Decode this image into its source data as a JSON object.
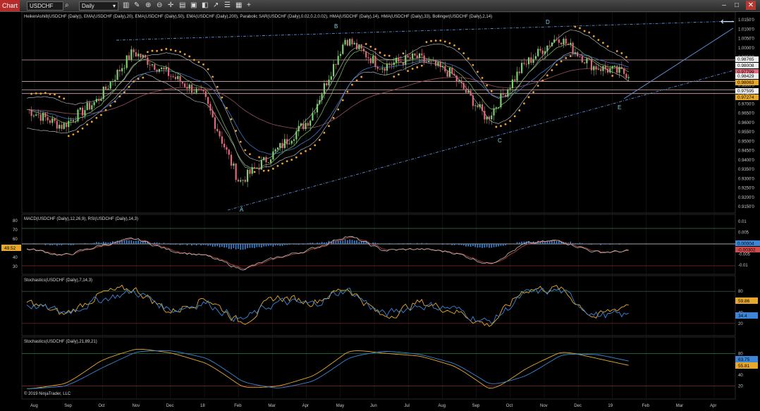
{
  "toolbar": {
    "app_label": "Chart",
    "instrument": "USDCHF",
    "interval": "Daily"
  },
  "icons": [
    "search-icon",
    "chevron-down-icon",
    "bar-style-icon",
    "draw-icon",
    "zoom-in-icon",
    "zoom-out-icon",
    "crosshair-icon",
    "properties-icon",
    "lock-icon",
    "data-box-icon",
    "drawing-tools-icon",
    "objects-icon",
    "templates-icon",
    "add-icon",
    "minimize-icon",
    "maximize-icon",
    "close-icon"
  ],
  "colors": {
    "up": "#7cd16e",
    "down": "#e06a7c",
    "sar": "#f2a030",
    "ema20": "#6fae5a",
    "ema50": "#3f78c4",
    "ema200": "#9b4f5a",
    "bollinger": "#c9c9c9",
    "trendline": "#5b8fd6",
    "hline": "#d9a8a8",
    "macd": "#cfcfcf",
    "signal": "#c94a3c",
    "hist": "#3b86d8",
    "stoch_d": "#3b86d8",
    "stoch_k": "#e8a92a"
  },
  "panels": {
    "price": {
      "label": "HeikenAshi8(USDCHF (Daily)), EMA(USDCHF (Daily),20), EMA(USDCHF (Daily),50), EMA(USDCHF (Daily),200), Parabolic SAR(USDCHF (Daily),0.02,0.2,0.02), HMA(USDCHF (Daily),14), HMA(USDCHF (Daily),33), Bollinger(USDCHF (Daily),2,14)"
    },
    "macd": {
      "label": "MACD(USDCHF (Daily),12,26,9), RSI(USDCHF (Daily),14,3)",
      "rsi_tag": "49.52",
      "macd_tag": "0.00004",
      "signal_tag": "-0.00302"
    },
    "stoch1": {
      "label": "Stochastics(USDCHF (Daily),7,14,3)",
      "k_tag": "59.86",
      "d_tag": "34.4"
    },
    "stoch2": {
      "label": "Stochastics(USDCHF (Daily),21,89,21)",
      "d_tag": "63.75",
      "k_tag": "55.81"
    }
  },
  "copyright": "© 2019 NinjaTrader, LLC",
  "price_axis": [
    "1.0150'0",
    "1.0100'0",
    "1.0050'0",
    "1.0000'0",
    "0.9950'0",
    "0.9900'0",
    "0.9850'0",
    "0.9800'0",
    "0.9750'0",
    "0.9700'0",
    "0.9650'0",
    "0.9600'0",
    "0.9550'0",
    "0.9500'0",
    "0.9450'0",
    "0.9400'0",
    "0.9350'0",
    "0.9300'0",
    "0.9250'0",
    "0.9200'0",
    "0.9150'0"
  ],
  "price_tags": [
    {
      "text": "0.98765",
      "color": "#f0f0f0"
    },
    {
      "text": "0.98008",
      "color": "#f0f0f0"
    },
    {
      "text": "0.97799",
      "color": "#e06a7c"
    },
    {
      "text": "0.98429",
      "color": "#f0f0f0"
    },
    {
      "text": "0.98063",
      "color": "#e8a92a"
    },
    {
      "text": "0.97595",
      "color": "#f0f0f0"
    },
    {
      "text": "0.97274",
      "color": "#e8a92a"
    }
  ],
  "macd_axis_left": [
    "80",
    "70",
    "60",
    "50",
    "40",
    "30"
  ],
  "macd_axis_right": [
    "0.01",
    "0.005",
    "0",
    "-0.005",
    "-0.01"
  ],
  "stoch_axis": [
    "80",
    "60",
    "40",
    "20"
  ],
  "x_axis": [
    "Aug",
    "Sep",
    "Oct",
    "Nov",
    "Dec",
    "18",
    "Feb",
    "Mar",
    "Apr",
    "May",
    "Jun",
    "Jul",
    "Aug",
    "Sep",
    "Oct",
    "Nov",
    "Dec",
    "19",
    "Feb",
    "Mar",
    "Apr"
  ],
  "wave_labels": [
    "A",
    "B",
    "C",
    "D",
    "E"
  ],
  "chart_data": [
    {
      "type": "candlestick",
      "title": "HeikenAshi8(USDCHF (Daily))",
      "x": [
        "Aug",
        "Sep",
        "Oct",
        "Nov",
        "Dec",
        "18",
        "Feb",
        "Mar",
        "Apr",
        "May",
        "Jun",
        "Jul",
        "Aug",
        "Sep",
        "Oct",
        "Nov",
        "Dec",
        "19"
      ],
      "series": [
        {
          "name": "USDCHF close (approx.)",
          "values": [
            0.967,
            0.958,
            0.972,
            0.998,
            0.986,
            0.974,
            0.928,
            0.944,
            0.962,
            1.005,
            0.99,
            0.995,
            0.986,
            0.962,
            0.99,
            1.006,
            0.99,
            0.986
          ]
        }
      ],
      "ylim": [
        0.9125,
        1.016
      ],
      "horizontal_lines": [
        0.9935,
        0.982,
        0.9775,
        0.9755
      ]
    },
    {
      "type": "line",
      "title": "MACD(USDCHF (Daily),12,26,9), RSI(USDCHF (Daily),14,3)",
      "x": [
        "Aug",
        "Sep",
        "Oct",
        "Nov",
        "Dec",
        "18",
        "Feb",
        "Mar",
        "Apr",
        "May",
        "Jun",
        "Jul",
        "Aug",
        "Sep",
        "Oct",
        "Nov",
        "Dec",
        "19"
      ],
      "series": [
        {
          "name": "RSI(USDCHF (Daily),14,3)",
          "values": [
            52,
            44,
            56,
            64,
            50,
            44,
            28,
            42,
            52,
            68,
            50,
            52,
            48,
            34,
            58,
            62,
            48,
            49.52
          ]
        }
      ],
      "ylim": [
        25,
        85
      ]
    },
    {
      "type": "line",
      "title": "Stochastics(USDCHF (Daily),7,14,3)",
      "x": [
        "Aug",
        "Sep",
        "Oct",
        "Nov",
        "Dec",
        "18",
        "Feb",
        "Mar",
        "Apr",
        "May",
        "Jun",
        "Jul",
        "Aug",
        "Sep",
        "Oct",
        "Nov",
        "Dec",
        "19"
      ],
      "series": [
        {
          "name": "K",
          "values": [
            60,
            35,
            75,
            85,
            40,
            70,
            20,
            70,
            60,
            88,
            30,
            60,
            45,
            15,
            85,
            85,
            30,
            59.86
          ]
        },
        {
          "name": "D",
          "values": [
            55,
            40,
            65,
            80,
            45,
            60,
            25,
            60,
            55,
            85,
            35,
            55,
            48,
            20,
            75,
            82,
            35,
            34.4
          ]
        }
      ],
      "ylim": [
        0,
        100
      ]
    },
    {
      "type": "line",
      "title": "Stochastics(USDCHF (Daily),21,89,21)",
      "x": [
        "Aug",
        "Sep",
        "Oct",
        "Nov",
        "Dec",
        "18",
        "Feb",
        "Mar",
        "Apr",
        "May",
        "Jun",
        "Jul",
        "Aug",
        "Sep",
        "Oct",
        "Nov",
        "Dec",
        "19"
      ],
      "series": [
        {
          "name": "K",
          "values": [
            15,
            25,
            70,
            90,
            80,
            60,
            15,
            20,
            40,
            88,
            80,
            75,
            55,
            10,
            55,
            85,
            70,
            55.81
          ]
        },
        {
          "name": "D",
          "values": [
            15,
            20,
            55,
            85,
            85,
            70,
            25,
            15,
            30,
            75,
            85,
            78,
            60,
            20,
            40,
            80,
            78,
            63.75
          ]
        }
      ],
      "ylim": [
        0,
        100
      ]
    }
  ]
}
